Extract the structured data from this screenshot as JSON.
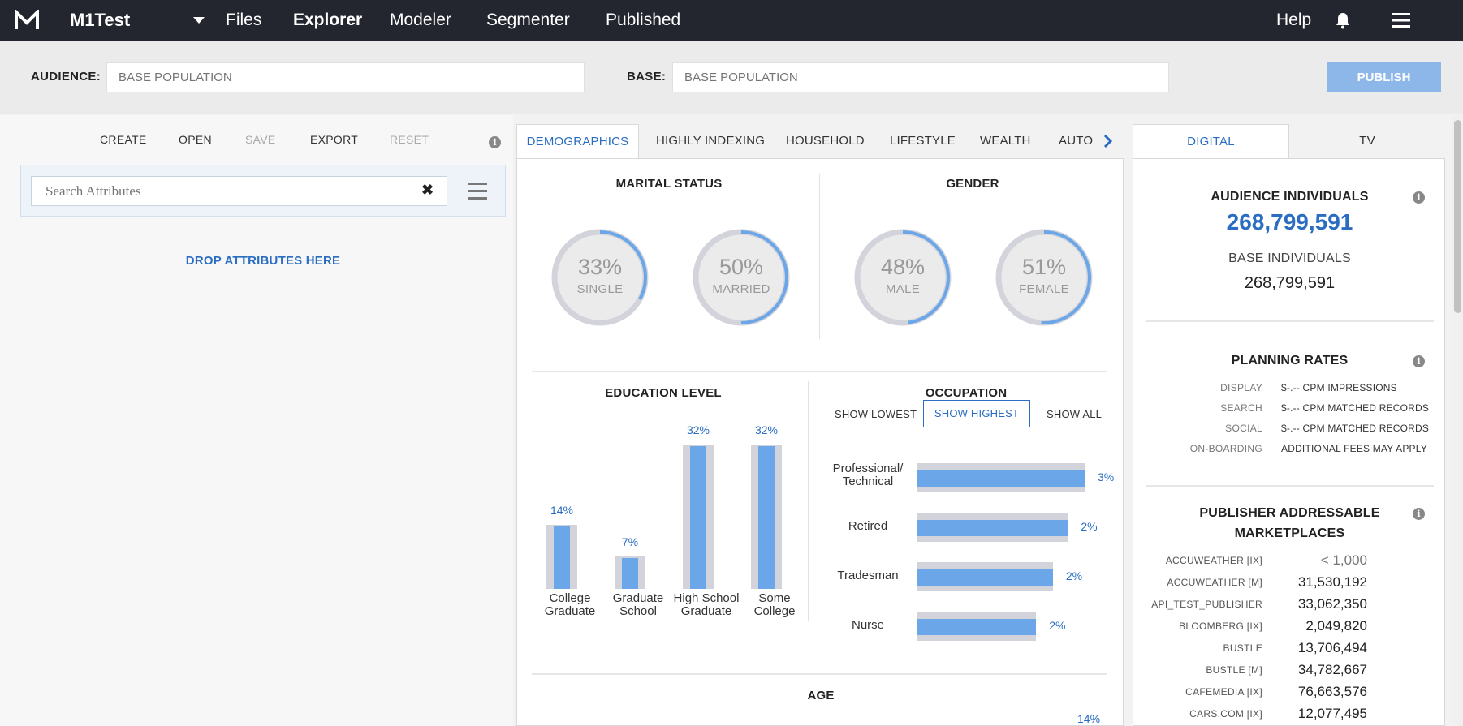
{
  "nav": {
    "brand": "M1Test",
    "links": [
      "Files",
      "Explorer",
      "Modeler",
      "Segmenter",
      "Published"
    ],
    "active": "Explorer",
    "help": "Help"
  },
  "audience": {
    "audience_label": "AUDIENCE:",
    "audience_placeholder": "BASE POPULATION",
    "base_label": "BASE:",
    "base_placeholder": "BASE POPULATION",
    "publish": "PUBLISH"
  },
  "left": {
    "toolbar": [
      {
        "label": "CREATE",
        "enabled": true
      },
      {
        "label": "OPEN",
        "enabled": true
      },
      {
        "label": "SAVE",
        "enabled": false
      },
      {
        "label": "EXPORT",
        "enabled": true
      },
      {
        "label": "RESET",
        "enabled": false
      }
    ],
    "search_placeholder": "Search Attributes",
    "drop_text": "DROP ATTRIBUTES HERE"
  },
  "tabs": [
    "DEMOGRAPHICS",
    "HIGHLY INDEXING",
    "HOUSEHOLD",
    "LIFESTYLE",
    "WEALTH",
    "AUTO I"
  ],
  "marital": {
    "title": "MARITAL STATUS",
    "items": [
      {
        "pct": "33%",
        "label": "SINGLE",
        "value": 33
      },
      {
        "pct": "50%",
        "label": "MARRIED",
        "value": 50
      }
    ]
  },
  "gender": {
    "title": "GENDER",
    "items": [
      {
        "pct": "48%",
        "label": "MALE",
        "value": 48
      },
      {
        "pct": "51%",
        "label": "FEMALE",
        "value": 51
      }
    ]
  },
  "education": {
    "title": "EDUCATION LEVEL",
    "bars": [
      {
        "label": "College Graduate",
        "value": 14,
        "text": "14%"
      },
      {
        "label": "Graduate School",
        "value": 7,
        "text": "7%"
      },
      {
        "label": "High School Graduate",
        "value": 32,
        "text": "32%"
      },
      {
        "label": "Some College",
        "value": 32,
        "text": "32%"
      }
    ]
  },
  "occupation": {
    "title": "OCCUPATION",
    "buttons": [
      "SHOW LOWEST",
      "SHOW HIGHEST",
      "SHOW ALL"
    ],
    "active_button": "SHOW HIGHEST",
    "bars": [
      {
        "label": "Professional/ Technical",
        "value": 3,
        "text": "3%",
        "fill": 1.0
      },
      {
        "label": "Retired",
        "value": 2,
        "text": "2%",
        "fill": 0.9
      },
      {
        "label": "Tradesman",
        "value": 2,
        "text": "2%",
        "fill": 0.81
      },
      {
        "label": "Nurse",
        "value": 2,
        "text": "2%",
        "fill": 0.71
      }
    ]
  },
  "age": {
    "title": "AGE",
    "first_value": "14%"
  },
  "right": {
    "tabs": [
      "DIGITAL",
      "TV"
    ],
    "audience_title": "AUDIENCE INDIVIDUALS",
    "audience_value": "268,799,591",
    "base_title": "BASE INDIVIDUALS",
    "base_value": "268,799,591",
    "rates_title": "PLANNING RATES",
    "rates": [
      {
        "k": "DISPLAY",
        "v": "$-.-- CPM IMPRESSIONS"
      },
      {
        "k": "SEARCH",
        "v": "$-.-- CPM MATCHED RECORDS"
      },
      {
        "k": "SOCIAL",
        "v": "$-.-- CPM MATCHED RECORDS"
      },
      {
        "k": "ON-BOARDING",
        "v": "ADDITIONAL FEES MAY APPLY"
      }
    ],
    "mp_title_1": "PUBLISHER ADDRESSABLE",
    "mp_title_2": "MARKETPLACES",
    "marketplaces": [
      {
        "k": "ACCUWEATHER [IX]",
        "v": "< 1,000"
      },
      {
        "k": "ACCUWEATHER [M]",
        "v": "31,530,192"
      },
      {
        "k": "API_TEST_PUBLISHER",
        "v": "33,062,350"
      },
      {
        "k": "BLOOMBERG [IX]",
        "v": "2,049,820"
      },
      {
        "k": "BUSTLE",
        "v": "13,706,494"
      },
      {
        "k": "BUSTLE [M]",
        "v": "34,782,667"
      },
      {
        "k": "CAFEMEDIA [IX]",
        "v": "76,663,576"
      },
      {
        "k": "CARS.COM [IX]",
        "v": "12,077,495"
      }
    ]
  },
  "colors": {
    "accent": "#2a6dc2",
    "bar": "#6aa6e8",
    "bar_bg": "#d3d4db",
    "nav_bg": "#23262f",
    "publish": "#8cb7e8"
  }
}
